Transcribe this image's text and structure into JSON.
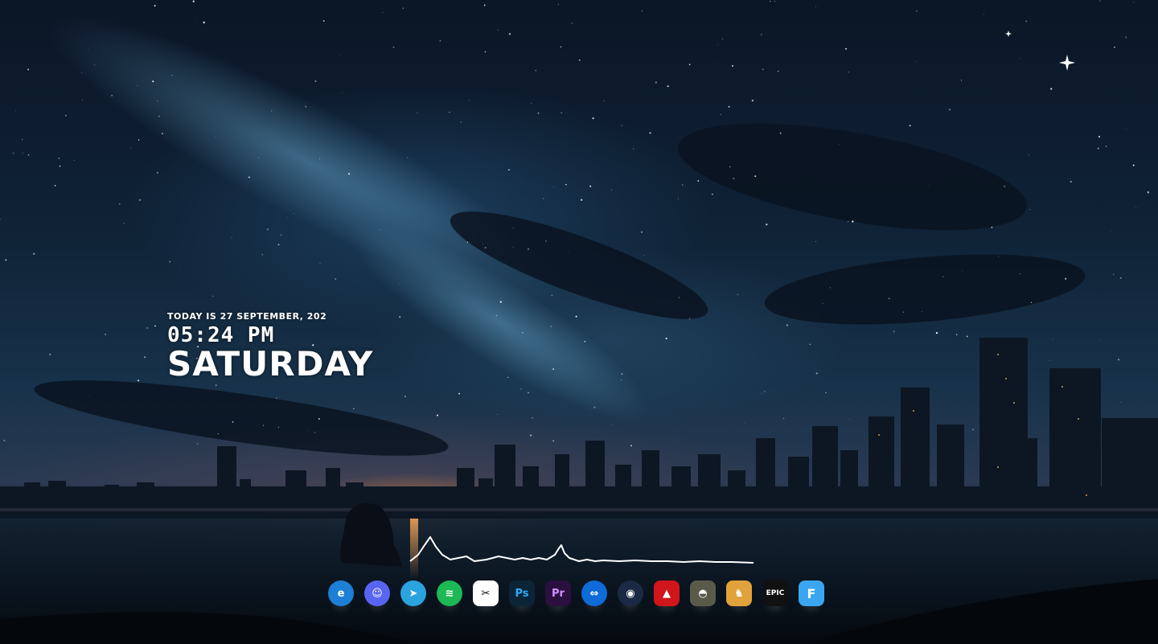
{
  "clock": {
    "date": "TODAY IS 27 SEPTEMBER, 202",
    "time": "05:24 PM",
    "day": "SATURDAY"
  },
  "dock": {
    "apps": [
      {
        "name": "edge-icon",
        "glyph": "e",
        "bg": "#1e7fd6"
      },
      {
        "name": "discord-icon",
        "glyph": "☺",
        "bg": "#5865f2"
      },
      {
        "name": "telegram-icon",
        "glyph": "➤",
        "bg": "#2aa3df"
      },
      {
        "name": "spotify-icon",
        "glyph": "≋",
        "bg": "#1db954"
      },
      {
        "name": "capcut-icon",
        "glyph": "✂",
        "bg": "#ffffff"
      },
      {
        "name": "photoshop-icon",
        "glyph": "Ps",
        "bg": "#0b2536"
      },
      {
        "name": "premiere-icon",
        "glyph": "Pr",
        "bg": "#2a0f3f"
      },
      {
        "name": "teamviewer-icon",
        "glyph": "⇔",
        "bg": "#0e6bd8"
      },
      {
        "name": "steam-icon",
        "glyph": "◉",
        "bg": "#1b2a44"
      },
      {
        "name": "apex-legends-icon",
        "glyph": "▲",
        "bg": "#d0161b"
      },
      {
        "name": "pubg-icon",
        "glyph": "◓",
        "bg": "#5a5a4a"
      },
      {
        "name": "counter-strike-icon",
        "glyph": "♞",
        "bg": "#e0a23a"
      },
      {
        "name": "epic-games-icon",
        "glyph": "EPIC",
        "bg": "#111111"
      },
      {
        "name": "fortnite-icon",
        "glyph": "F",
        "bg": "#3aa6f0"
      }
    ]
  },
  "colors": {
    "clock_text": "#ffffff",
    "visualizer": "#ffffff"
  }
}
